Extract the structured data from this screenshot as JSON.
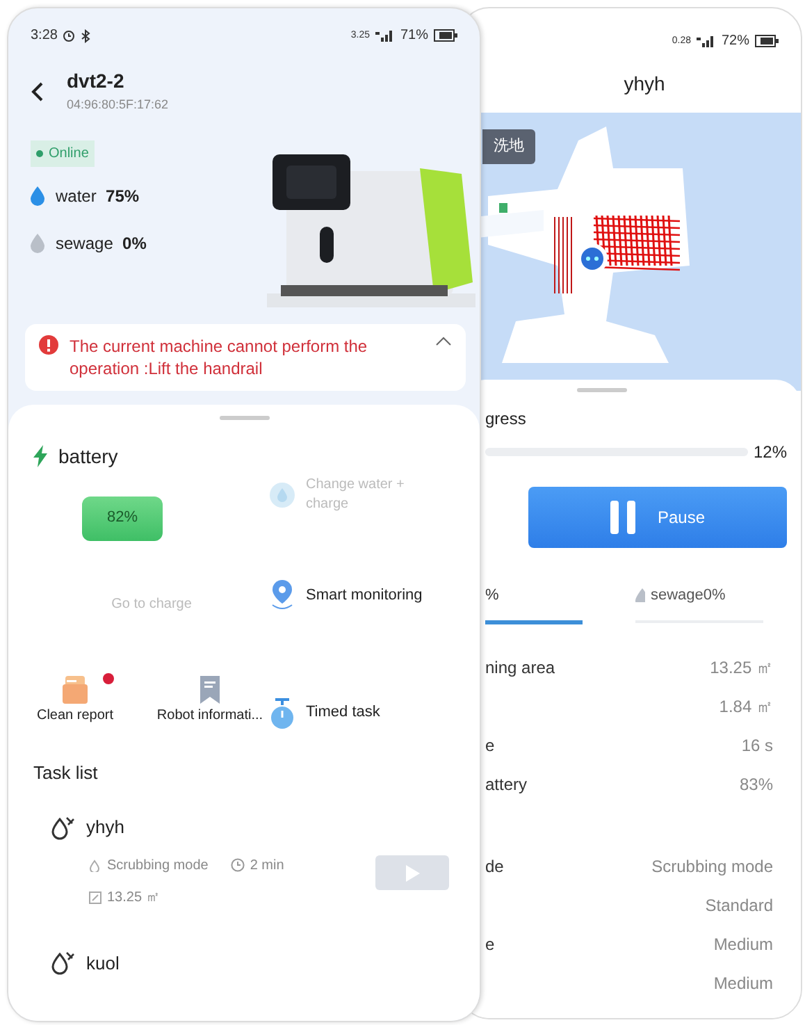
{
  "device_screen": {
    "status_bar": {
      "time": "3:28",
      "speed": "3.25",
      "battery": "71%"
    },
    "header": {
      "title": "dvt2-2",
      "subtitle": "04:96:80:5F:17:62"
    },
    "status_badge": "Online",
    "tanks": [
      {
        "kind": "water",
        "label": "water",
        "value": "75%"
      },
      {
        "kind": "sewage",
        "label": "sewage",
        "value": "0%"
      }
    ],
    "alert": {
      "message": "The current machine cannot perform the operation :Lift the handrail"
    },
    "battery": {
      "label": "battery",
      "value": "82%"
    },
    "actions": [
      {
        "kind": "change_water",
        "label": "Change water + charge",
        "disabled": true,
        "notification": false
      },
      {
        "kind": "charge",
        "label": "Go to charge",
        "disabled": true,
        "notification": false
      },
      {
        "kind": "monitor",
        "label": "Smart monitoring",
        "disabled": false,
        "notification": false
      },
      {
        "kind": "report",
        "label": "Clean report",
        "disabled": false,
        "notification": true
      },
      {
        "kind": "info",
        "label": "Robot informati...",
        "disabled": false,
        "notification": false
      },
      {
        "kind": "timer",
        "label": "Timed task",
        "disabled": false,
        "notification": false
      }
    ],
    "task_list": {
      "title": "Task list",
      "tasks": [
        {
          "name": "yhyh",
          "mode": "Scrubbing mode",
          "duration": "2 min",
          "area": "13.25 ㎡",
          "play_disabled": true
        },
        {
          "name": "kuol"
        }
      ]
    }
  },
  "task_screen": {
    "status_bar": {
      "speed": "0.28",
      "battery": "72%"
    },
    "title": "yhyh",
    "map_label": "洗地",
    "progress": {
      "label": "gress",
      "value": "12%"
    },
    "pause_label": "Pause",
    "tabs": [
      {
        "label": "%",
        "selected": true
      },
      {
        "label": "sewage0%",
        "selected": false
      }
    ],
    "stats": [
      {
        "label": "ning area",
        "value": "13.25 ㎡"
      },
      {
        "value": "1.84 ㎡"
      },
      {
        "label": "e",
        "value": "16 s"
      },
      {
        "label": "attery",
        "value": "83%"
      }
    ],
    "settings": [
      {
        "label": "de",
        "value": "Scrubbing mode"
      },
      {
        "value": "Standard"
      },
      {
        "label": "e",
        "value": "Medium"
      },
      {
        "value": "Medium"
      }
    ]
  }
}
